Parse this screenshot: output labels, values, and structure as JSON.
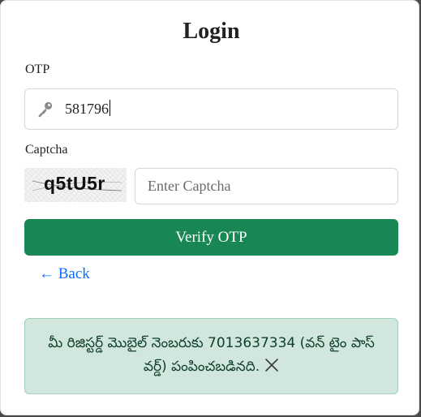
{
  "page": {
    "title": "Login"
  },
  "otp": {
    "label": "OTP",
    "value": "581796",
    "icon": "key-icon"
  },
  "captcha": {
    "label": "Captcha",
    "image_text": "q5tU5r",
    "input_placeholder": "Enter Captcha"
  },
  "actions": {
    "verify_label": "Verify OTP",
    "back_label": "← Back"
  },
  "alert": {
    "message": "మీ రిజిస్టర్డ్ మొబైల్ నెంబరుకు 7013637334 (వన్ టైం పాస్ వర్డ్) పంపించబడినది.",
    "close_icon": "close-icon",
    "background": "#d1e7dd"
  },
  "colors": {
    "primary_button": "#198754",
    "link": "#0d6efd"
  }
}
